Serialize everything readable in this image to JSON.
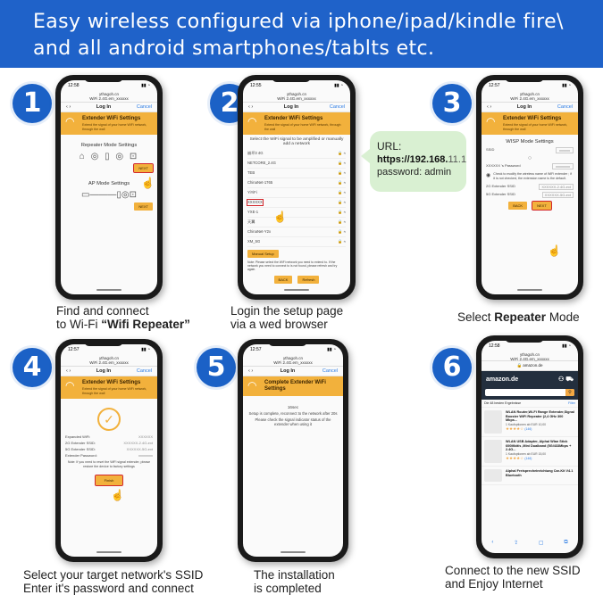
{
  "banner": {
    "line1": "Easy wireless configured via iphone/ipad/kindle fire\\",
    "line2": "and all android smartphones/tablts etc."
  },
  "steps": [
    {
      "number": "1",
      "caption_line1": "Find and connect",
      "caption_line2_prefix": "to Wi-Fi ",
      "caption_line2_bold": "“Wifi Repeater”"
    },
    {
      "number": "2",
      "caption_line1": "Login the setup page",
      "caption_line2": "via a wed browser"
    },
    {
      "number": "3",
      "caption_prefix": "Select ",
      "caption_bold": "Repeater",
      "caption_suffix": " Mode"
    },
    {
      "number": "4",
      "caption_line1": "Select your target network's SSID",
      "caption_line2": "Enter it's password and connect"
    },
    {
      "number": "5",
      "caption_line1": "The installation",
      "caption_line2": "is completed"
    },
    {
      "number": "6",
      "caption_line1": "Connect to the new SSID",
      "caption_line2": "and Enjoy Internet"
    }
  ],
  "url_note": {
    "label": "URL:",
    "url_bold": "https://192.168.",
    "url_rest": "11.1",
    "password": "password: admin"
  },
  "phone_common": {
    "time": "12:58",
    "url_line1": "ythagoh.cn",
    "url_line2": "WiFi 2.4G.em_xxxxxx",
    "nav_title": "Log In",
    "nav_cancel": "Cancel",
    "header_title": "Extender WiFi Settings",
    "header_sub": "Extend the signal of your home WiFi network, through the wall"
  },
  "phone1": {
    "repeater_heading": "Repeater Mode Settings",
    "ap_heading": "AP Mode Settings",
    "next": "NEXT"
  },
  "phone2": {
    "time": "12:55",
    "prompt": "Select the WiFi signal to be amplified or manually add a network",
    "networks": [
      "崩坏3 4G",
      "NETCORE_2.4G",
      "TEB",
      "ChinaNet-1765",
      "YiYiFi",
      "XXXXXX",
      "YXE-1",
      "天翼",
      "ChinaNet-Y2x",
      "XM_5G"
    ],
    "manual_setup": "Manual Setup",
    "note": "Note: Please select the WiFi network you need to extend to. If the network you need to connect to is not found, please refresh and try again.",
    "back": "BACK",
    "refresh": "Refresh"
  },
  "phone3": {
    "time": "12:57",
    "heading": "WISP Mode Settings",
    "ssid_label": "SSID",
    "ssid_value": "xxxxxx",
    "password_label": "XXXXXX 's Password",
    "password_value": "xxxxxxxx",
    "check_text": "Check to modify the wireless name of WiFi extender ; if it is not checked, the extension name is the default.",
    "ssid24_label": "2G Extender SSID",
    "ssid24_value": "XXXXXX-2.4G-ext",
    "ssid5_label": "5G Extender SSID",
    "ssid5_value": "XXXXXX-5G-ext",
    "back": "BACK",
    "next": "NEXT"
  },
  "phone4": {
    "time": "12:57",
    "rows": [
      {
        "k": "Expanded WiFi:",
        "v": "XXXXXX"
      },
      {
        "k": "2G Extender SSID:",
        "v": "XXXXXX-2.4G-ext"
      },
      {
        "k": "5G Extender SSID:",
        "v": "XXXXXX-5G-ext"
      },
      {
        "k": "Extender Password:",
        "v": "xxxxxxxx"
      }
    ],
    "note": "Note: If you need to reset the WiFi signal extender, please restore the device to factory settings",
    "finish": "Finish"
  },
  "phone5": {
    "time": "12:57",
    "header_title": "Complete Extender WiFi Settings",
    "countdown": "16sec",
    "msg1": "Setup is complete, reconnect to the network after 20s",
    "msg2": "Please check the signal indicator status of the extender when using it"
  },
  "phone6": {
    "time": "12:58",
    "site": "amazon.de",
    "logo": "amazon.de",
    "results_label": "Die 48 besten Ergebnisse",
    "filter": "Filter",
    "products": [
      {
        "title": "WLAN Router,Wi-Fi Range Extender,Signal Booster WiFi Repeater (2,4 GHz 300 Mbps...",
        "price": "1 Kaufoptionen ab EUR 10,00",
        "reviews": "(146)"
      },
      {
        "title": "WLAN USB Adapter, Alphal Wlan Stick 600Mbit/s ,Mini Dualband (5G/433Mbps + 2.4G...",
        "price": "1 Kaufoptionen ab EUR 15,00",
        "reviews": "(146)"
      },
      {
        "title": "Alphal Freisprecheinrichtung Car-Kit V4.1 Bluetooth",
        "price": "",
        "reviews": ""
      }
    ]
  }
}
